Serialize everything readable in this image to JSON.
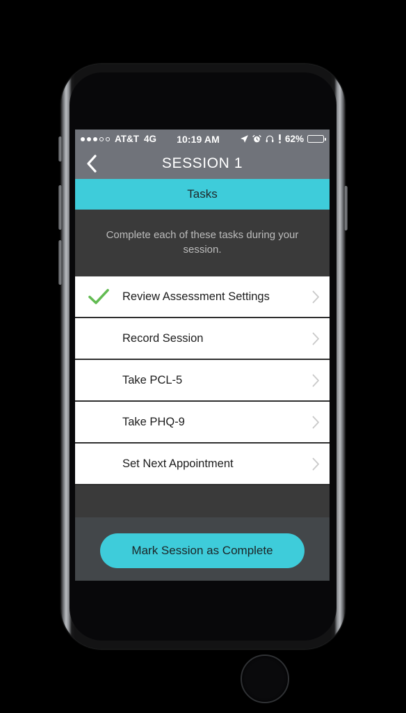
{
  "status_bar": {
    "signal_dots": [
      true,
      true,
      true,
      false,
      false
    ],
    "carrier": "AT&T",
    "network": "4G",
    "time": "10:19 AM",
    "icons": [
      "location-arrow-icon",
      "alarm-clock-icon",
      "headphones-icon",
      "do-not-disturb-icon"
    ],
    "battery_percent": "62%",
    "battery_level": 62
  },
  "nav_bar": {
    "back_icon": "chevron-left-icon",
    "title": "SESSION 1"
  },
  "section": {
    "header": "Tasks",
    "description": "Complete each of these tasks during your session."
  },
  "tasks": [
    {
      "label": "Review Assessment Settings",
      "completed": true,
      "chevron": "chevron-right-icon"
    },
    {
      "label": "Record Session",
      "completed": false,
      "chevron": "chevron-right-icon"
    },
    {
      "label": "Take PCL-5",
      "completed": false,
      "chevron": "chevron-right-icon"
    },
    {
      "label": "Take PHQ-9",
      "completed": false,
      "chevron": "chevron-right-icon"
    },
    {
      "label": "Set Next Appointment",
      "completed": false,
      "chevron": "chevron-right-icon"
    }
  ],
  "footer": {
    "complete_button_label": "Mark Session as Complete"
  },
  "colors": {
    "accent_teal": "#3eccda",
    "nav_gray": "#70737a",
    "screen_dark": "#3a3a3a",
    "footer_gray": "#43474a",
    "check_green": "#62bb52",
    "row_white": "#ffffff"
  }
}
